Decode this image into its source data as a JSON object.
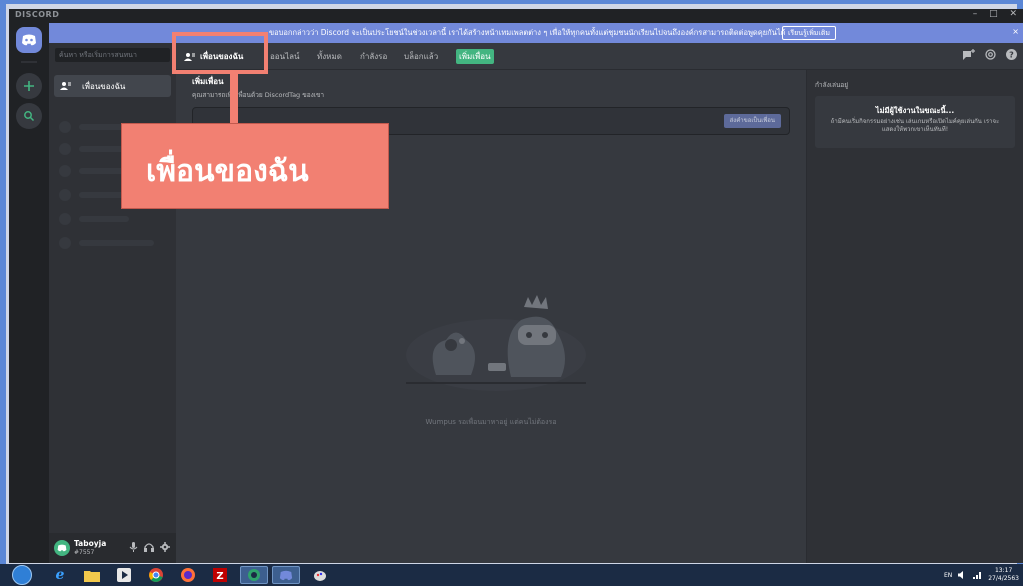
{
  "app": {
    "title": "DISCORD",
    "window_controls": [
      "–",
      "□",
      "✕"
    ]
  },
  "notice": {
    "text": "ขอบอกกล่าวว่า Discord จะเป็นประโยชน์ในช่วงเวลานี้ เราได้สร้างหน้าเทมเพลตต่าง ๆ เพื่อให้ทุกคนทั้งแต่ชุมชนนักเรียนไปจนถึงองค์กรสามารถติดต่อพูดคุยกันได้",
    "button": "เรียนรู้เพิ่มเติม",
    "close": "×"
  },
  "sidebar": {
    "search_placeholder": "ค้นหา หรือเริ่มการสนทนา",
    "friends_label": "เพื่อนของฉัน"
  },
  "user": {
    "name": "Taboyja",
    "tag": "#7557"
  },
  "tabs": {
    "friends": "เพื่อนของฉัน",
    "online": "ออนไลน์",
    "all": "ทั้งหมด",
    "pending": "กำลังรอ",
    "blocked": "บล็อกแล้ว",
    "add_friend": "เพิ่มเพื่อน"
  },
  "add_friend": {
    "title": "เพิ่มเพื่อน",
    "description": "คุณสามารถเพิ่มเพื่อนด้วย DiscordTag ของเขา",
    "button": "ส่งคำขอเป็นเพื่อน"
  },
  "empty_state": {
    "text": "Wumpus รอเพื่อนมาหาอยู่ แต่คนไม่ต้องรอ"
  },
  "activity": {
    "title": "กำลังเล่นอยู่",
    "card_title": "ไม่มีผู้ใช้งานในขณะนี้...",
    "card_body": "ถ้ามีคนเริ่มกิจกรรมอย่างเช่น เล่นเกมหรือเปิดไมค์คุยเล่นกัน เราจะแสดงให้พวกเขาเห็นทันที!"
  },
  "callout": {
    "label": "เพื่อนของฉัน",
    "color": "#f28072"
  },
  "taskbar": {
    "lang": "EN",
    "time": "13:17",
    "date": "27/4/2563"
  },
  "colors": {
    "blurple": "#7289da",
    "green": "#43b581",
    "bg_dark": "#202225",
    "bg_mid": "#2f3136",
    "bg_main": "#36393f"
  }
}
